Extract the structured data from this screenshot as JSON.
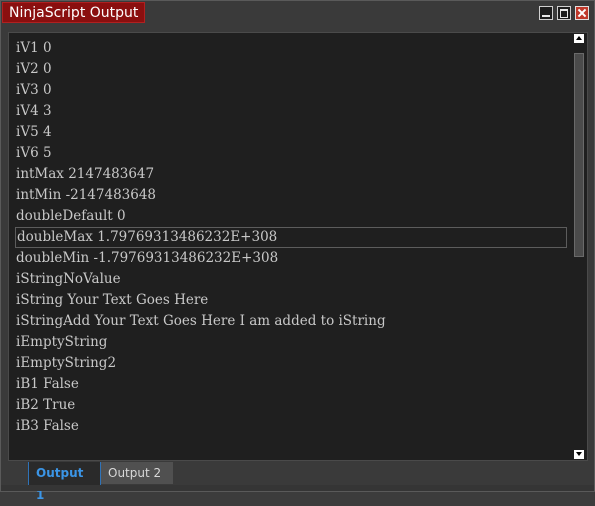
{
  "window": {
    "title": "NinjaScript Output"
  },
  "output": {
    "lines": [
      "iV1 0",
      "iV2 0",
      "iV3 0",
      "iV4 3",
      "iV5 4",
      "iV6 5",
      "intMax 2147483647",
      "intMin -2147483648",
      "doubleDefault 0",
      "doubleMax 1.79769313486232E+308",
      "doubleMin -1.79769313486232E+308",
      "iStringNoValue",
      "iString Your Text Goes Here",
      "iStringAdd Your Text Goes Here I am added to iString",
      "iEmptyString",
      "iEmptyString2",
      "iB1 False",
      "iB2 True",
      "iB3 False"
    ],
    "selected_index": 9
  },
  "tabs": [
    {
      "label": "Output 1",
      "active": true
    },
    {
      "label": "Output 2",
      "active": false
    }
  ],
  "colors": {
    "title_tab": "#8a0f0f",
    "active_tab_text": "#3b95e6",
    "background": "#1f1f1f",
    "text": "#c8c8c8"
  },
  "icons": {
    "minimize": "minimize-icon",
    "maximize": "maximize-icon",
    "close": "close-icon",
    "scroll_up": "arrow-up-icon",
    "scroll_down": "arrow-down-icon"
  }
}
